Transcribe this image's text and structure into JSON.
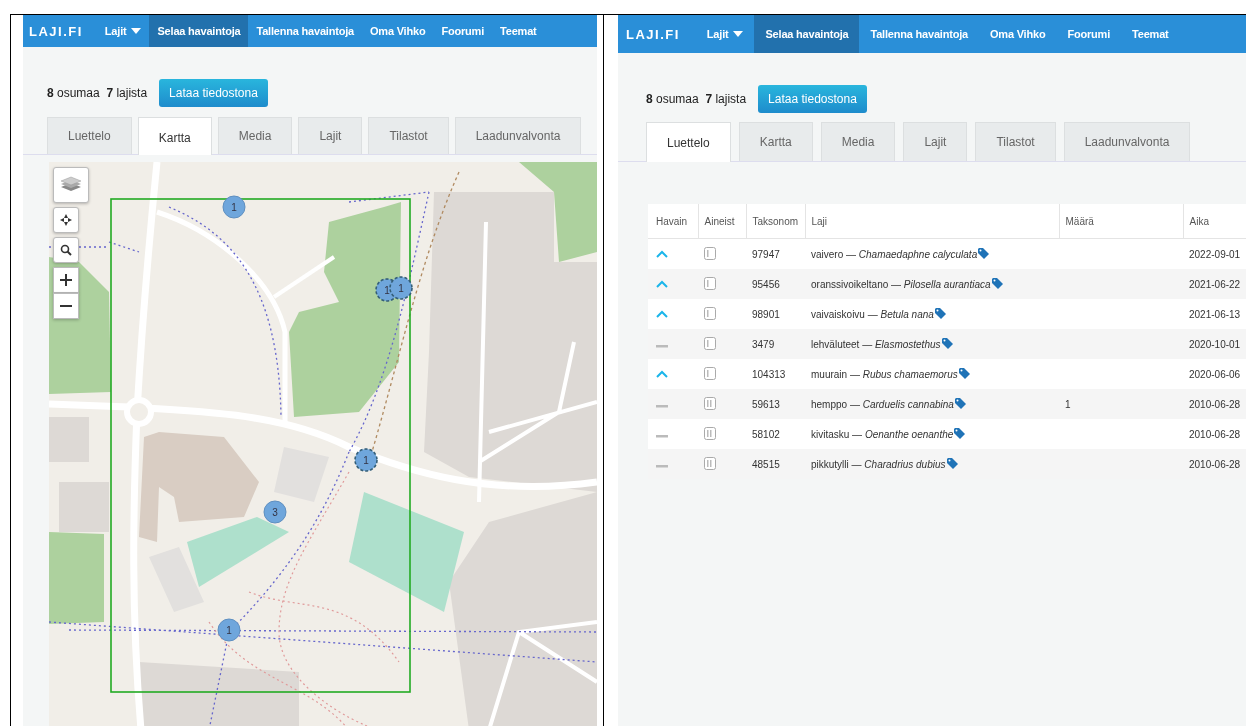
{
  "panels": [
    {
      "kind": "map",
      "header": {
        "logo": "LAJI.FI",
        "nav": [
          {
            "label": "Lajit",
            "dropdown": true,
            "selected": false
          },
          {
            "label": "Selaa havaintoja",
            "dropdown": false,
            "selected": true
          },
          {
            "label": "Tallenna havaintoja",
            "dropdown": false,
            "selected": false
          },
          {
            "label": "Oma Vihko",
            "dropdown": false,
            "selected": false
          },
          {
            "label": "Foorumi",
            "dropdown": false,
            "selected": false
          },
          {
            "label": "Teemat",
            "dropdown": false,
            "selected": false
          }
        ]
      },
      "summary": "**8** osumaa  **7** lajista",
      "download_button": "Lataa tiedostona",
      "tabs": [
        {
          "label": "Luettelo",
          "selected": false
        },
        {
          "label": "Kartta",
          "selected": true
        },
        {
          "label": "Media",
          "selected": false
        },
        {
          "label": "Lajit",
          "selected": false
        },
        {
          "label": "Tilastot",
          "selected": false
        },
        {
          "label": "Laadunvalvonta",
          "selected": false
        }
      ],
      "map": {
        "markers": [
          {
            "count": "1",
            "highlighted": false
          },
          {
            "count": "1",
            "highlighted": true
          },
          {
            "count": "1",
            "highlighted": true
          },
          {
            "count": "1",
            "highlighted": true
          },
          {
            "count": "3",
            "highlighted": false
          },
          {
            "count": "1",
            "highlighted": false
          }
        ]
      }
    },
    {
      "kind": "table",
      "header": {
        "logo": "LAJI.FI",
        "nav": [
          {
            "label": "Lajit",
            "dropdown": true,
            "selected": false
          },
          {
            "label": "Selaa havaintoja",
            "dropdown": false,
            "selected": true
          },
          {
            "label": "Tallenna havaintoja",
            "dropdown": false,
            "selected": false
          },
          {
            "label": "Oma Vihko",
            "dropdown": false,
            "selected": false
          },
          {
            "label": "Foorumi",
            "dropdown": false,
            "selected": false
          },
          {
            "label": "Teemat",
            "dropdown": false,
            "selected": false
          }
        ]
      },
      "summary": "**8** osumaa  **7** lajista",
      "download_button": "Lataa tiedostona",
      "tabs": [
        {
          "label": "Luettelo",
          "selected": true
        },
        {
          "label": "Kartta",
          "selected": false
        },
        {
          "label": "Media",
          "selected": false
        },
        {
          "label": "Lajit",
          "selected": false
        },
        {
          "label": "Tilastot",
          "selected": false
        },
        {
          "label": "Laadunvalvonta",
          "selected": false
        }
      ],
      "table": {
        "columns": [
          "Havain",
          "Aineist",
          "Taksonom",
          "Laji",
          "Määrä",
          "Aika"
        ],
        "rows": [
          {
            "quality_up": true,
            "double_record": false,
            "taxon_id": "97947",
            "species": "vaivero — *Chamaedaphne calyculata*",
            "date": "2022-09-01"
          },
          {
            "quality_up": true,
            "double_record": false,
            "taxon_id": "95456",
            "species": "oranssivoikeltano — *Pilosella aurantiaca*",
            "date": "2021-06-22"
          },
          {
            "quality_up": true,
            "double_record": false,
            "taxon_id": "98901",
            "species": "vaivaiskoivu — *Betula nana*",
            "date": "2021-06-13"
          },
          {
            "quality_up": false,
            "double_record": false,
            "taxon_id": "3479",
            "species": "lehväluteet — *Elasmostethus*",
            "date": "2020-10-01"
          },
          {
            "quality_up": true,
            "double_record": false,
            "taxon_id": "104313",
            "species": "muurain — *Rubus chamaemorus*",
            "date": "2020-06-06"
          },
          {
            "quality_up": false,
            "double_record": true,
            "taxon_id": "59613",
            "species": "hemppo — *Carduelis cannabina*",
            "count": "1",
            "date": "2010-06-28"
          },
          {
            "quality_up": false,
            "double_record": true,
            "taxon_id": "58102",
            "species": "kivitasku — *Oenanthe oenanthe*",
            "date": "2010-06-28"
          },
          {
            "quality_up": false,
            "double_record": true,
            "taxon_id": "48515",
            "species": "pikkutylli — *Charadrius dubius*",
            "date": "2010-06-28"
          }
        ]
      }
    }
  ]
}
